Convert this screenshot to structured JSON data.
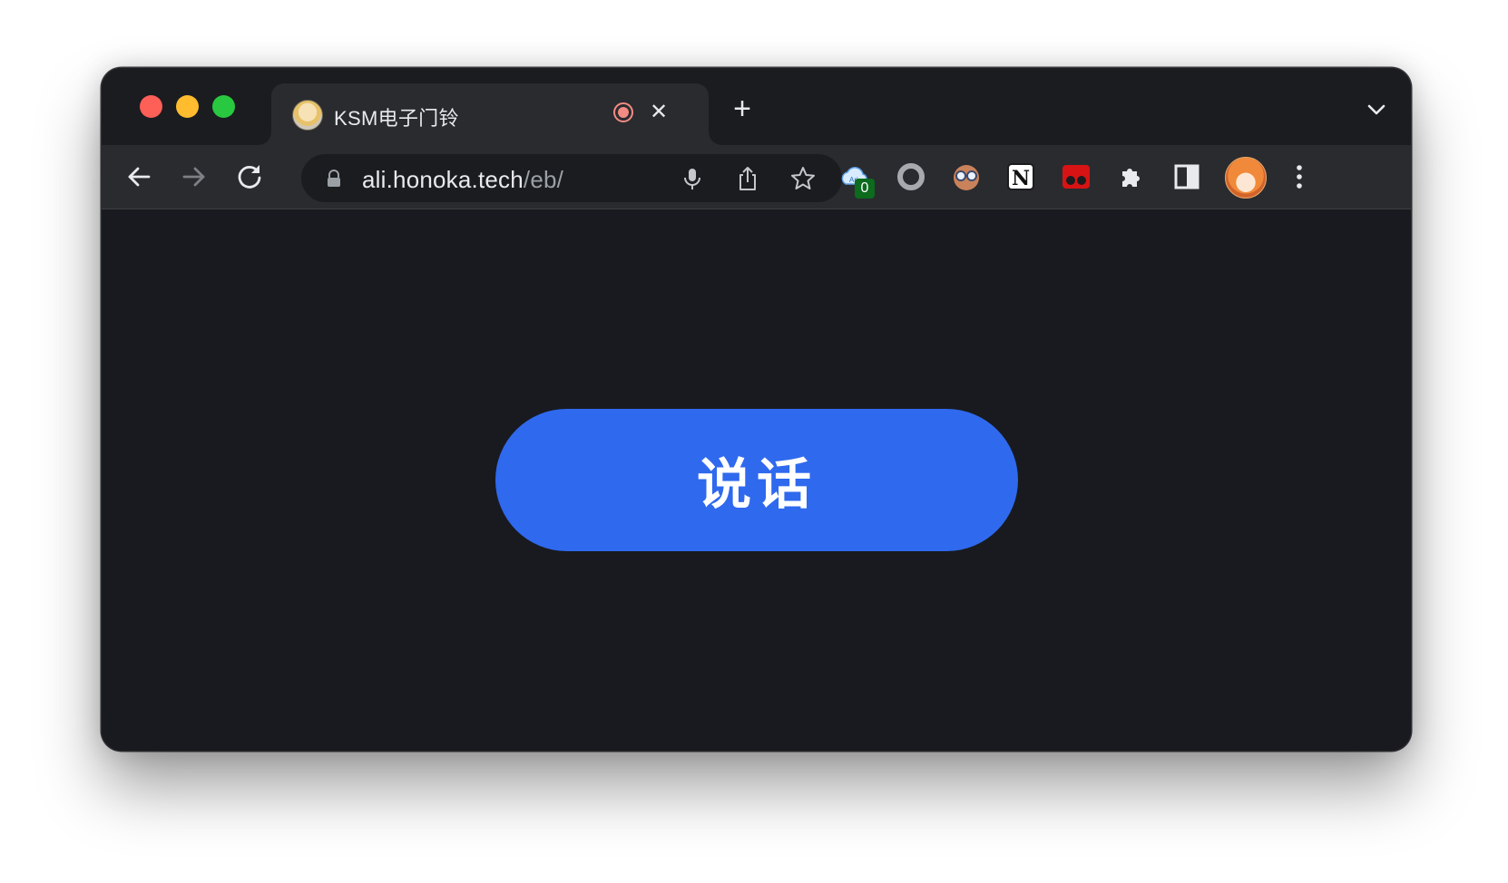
{
  "browser": {
    "tab": {
      "title": "KSM电子门铃",
      "favicon_icon": "anime-avatar-favicon",
      "recording_indicator": "recording-icon",
      "close_label": "✕"
    },
    "new_tab_label": "+",
    "address_bar": {
      "domain": "ali.honoka.tech",
      "path": "/eb/"
    },
    "extensions": [
      {
        "name": "aria2-cloud-extension",
        "badge": "0"
      },
      {
        "name": "ring-extension"
      },
      {
        "name": "glasses-face-extension"
      },
      {
        "name": "notion-extension"
      },
      {
        "name": "red-eyes-extension"
      },
      {
        "name": "puzzle-extensions-menu"
      },
      {
        "name": "side-panel-toggle"
      }
    ]
  },
  "page": {
    "talk_button_label": "说话"
  },
  "colors": {
    "accent_button": "#2f69ee",
    "page_background": "#181a1f",
    "toolbar_background": "#2a2b2f"
  }
}
